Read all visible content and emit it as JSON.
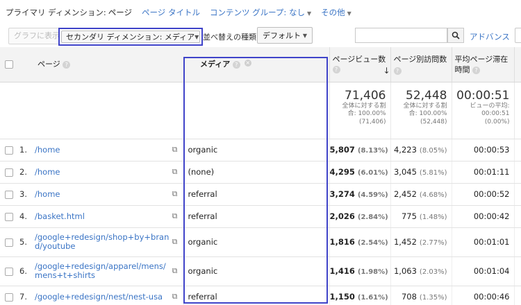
{
  "dimension_bar": {
    "primary_label": "プライマリ ディメンション:",
    "current": "ページ",
    "options": [
      "ページ タイトル",
      "コンテンツ グループ: なし"
    ],
    "more": "その他"
  },
  "toolbar": {
    "plot_button": "グラフに表示",
    "secondary_dimension": "セカンダリ ディメンション: メディア",
    "sort_label": "並べ替えの種類:",
    "sort_value": "デフォルト",
    "search_placeholder": "",
    "advanced": "アドバンス"
  },
  "columns": {
    "page": "ページ",
    "medium": "メディア",
    "pageviews": "ページビュー数",
    "unique": "ページ別訪問数",
    "avg_time_line1": "平均ページ滞在",
    "avg_time_line2": "時間"
  },
  "summary": {
    "pageviews": {
      "value": "71,406",
      "line1": "全体に対する割",
      "line2": "合: 100.00%",
      "line3": "(71,406)"
    },
    "unique": {
      "value": "52,448",
      "line1": "全体に対する割",
      "line2": "合: 100.00%",
      "line3": "(52,448)"
    },
    "avg_time": {
      "value": "00:00:51",
      "line1": "ビューの平均:",
      "line2": "00:00:51",
      "line3": "(0.00%)"
    }
  },
  "rows": [
    {
      "idx": "1.",
      "page": "/home",
      "medium": "organic",
      "pv": "5,807",
      "pv_pct": "(8.13%)",
      "up": "4,223",
      "up_pct": "(8.05%)",
      "time": "00:00:53"
    },
    {
      "idx": "2.",
      "page": "/home",
      "medium": "(none)",
      "pv": "4,295",
      "pv_pct": "(6.01%)",
      "up": "3,045",
      "up_pct": "(5.81%)",
      "time": "00:01:11"
    },
    {
      "idx": "3.",
      "page": "/home",
      "medium": "referral",
      "pv": "3,274",
      "pv_pct": "(4.59%)",
      "up": "2,452",
      "up_pct": "(4.68%)",
      "time": "00:00:52"
    },
    {
      "idx": "4.",
      "page": "/basket.html",
      "medium": "referral",
      "pv": "2,026",
      "pv_pct": "(2.84%)",
      "up": "775",
      "up_pct": "(1.48%)",
      "time": "00:00:42"
    },
    {
      "idx": "5.",
      "page": "/google+redesign/shop+by+bran",
      "page2": "d/youtube",
      "medium": "organic",
      "pv": "1,816",
      "pv_pct": "(2.54%)",
      "up": "1,452",
      "up_pct": "(2.77%)",
      "time": "00:01:01"
    },
    {
      "idx": "6.",
      "page": "/google+redesign/apparel/mens/",
      "page2": "mens+t+shirts",
      "medium": "organic",
      "pv": "1,416",
      "pv_pct": "(1.98%)",
      "up": "1,063",
      "up_pct": "(2.03%)",
      "time": "00:01:04"
    },
    {
      "idx": "7.",
      "page": "/google+redesign/nest/nest-usa",
      "medium": "referral",
      "pv": "1,150",
      "pv_pct": "(1.61%)",
      "up": "708",
      "up_pct": "(1.35%)",
      "time": "00:00:46"
    }
  ],
  "colors": {
    "link": "#3a74c5",
    "highlight": "#3f43c9"
  }
}
